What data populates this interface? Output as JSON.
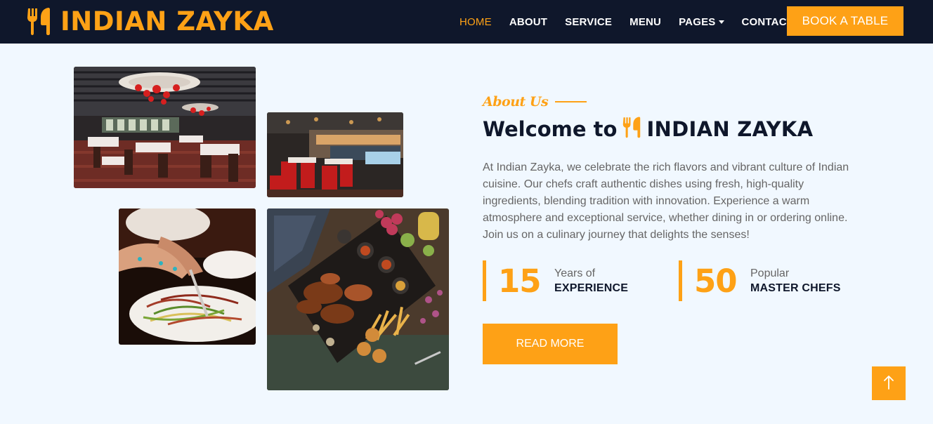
{
  "navbar": {
    "brand": "INDIAN ZAYKA",
    "brand_icon": "utensils-icon",
    "links": [
      {
        "label": "HOME",
        "active": true
      },
      {
        "label": "ABOUT",
        "active": false
      },
      {
        "label": "SERVICE",
        "active": false
      },
      {
        "label": "MENU",
        "active": false
      },
      {
        "label": "PAGES",
        "active": false,
        "dropdown": true
      },
      {
        "label": "CONTACT",
        "active": false
      }
    ],
    "book_button": "BOOK A TABLE"
  },
  "gallery": {
    "images": [
      {
        "name": "restaurant-interior-photo"
      },
      {
        "name": "dining-hall-photo"
      },
      {
        "name": "salad-dish-photo"
      },
      {
        "name": "grill-platter-photo"
      }
    ]
  },
  "about": {
    "label": "About Us",
    "heading_prefix": "Welcome to",
    "heading_brand": "INDIAN ZAYKA",
    "paragraph": "At Indian Zayka, we celebrate the rich flavors and vibrant culture of Indian cuisine. Our chefs craft authentic dishes using fresh, high-quality ingredients, blending tradition with innovation. Experience a warm atmosphere and exceptional service, whether dining in or ordering online. Join us on a culinary journey that delights the senses!",
    "stats": [
      {
        "number": "15",
        "small": "Years of",
        "big": "EXPERIENCE"
      },
      {
        "number": "50",
        "small": "Popular",
        "big": "MASTER CHEFS"
      }
    ],
    "read_more": "READ MORE"
  },
  "back_to_top_icon": "arrow-up-icon",
  "colors": {
    "accent": "#fea116",
    "navbar_bg": "#0f172b",
    "page_bg": "#f1f8ff",
    "heading": "#0f172b",
    "body_text": "#666565"
  }
}
